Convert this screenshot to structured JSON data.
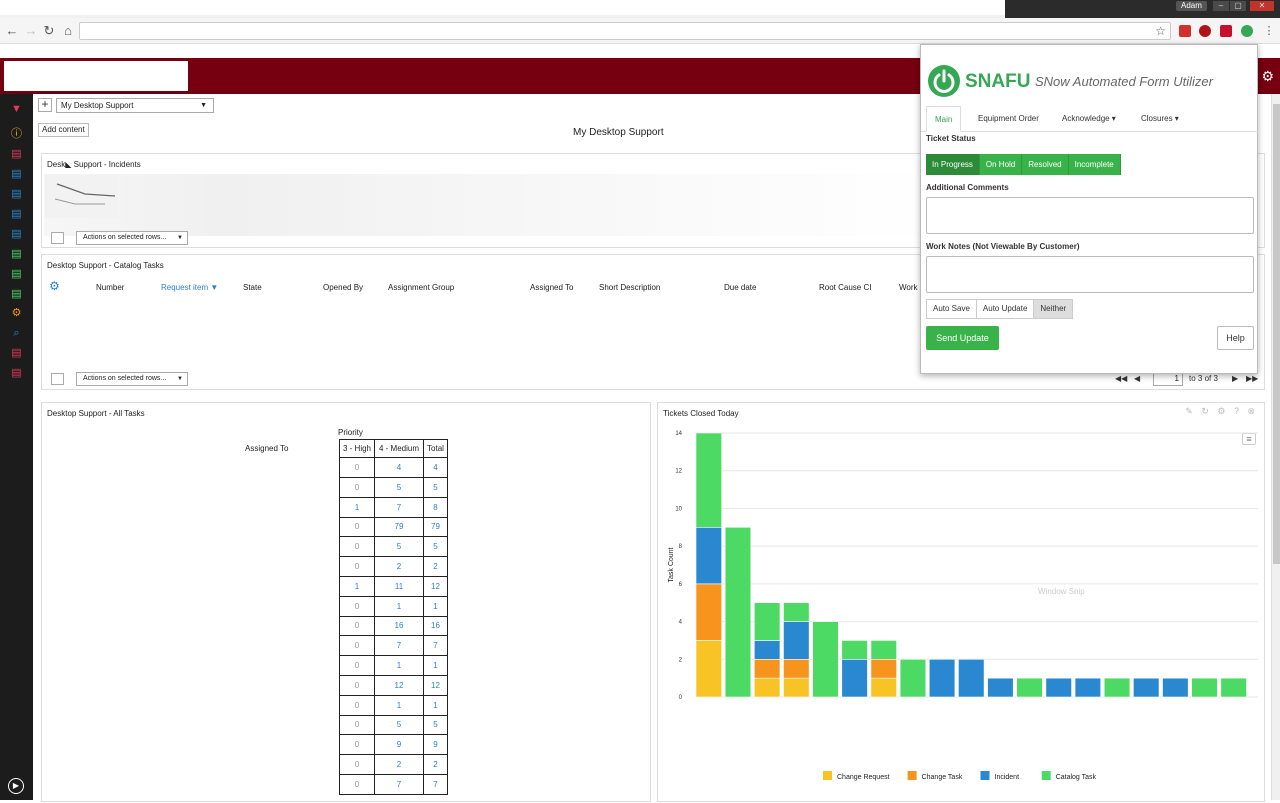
{
  "browser": {
    "user": "Adam",
    "window_buttons": [
      "–",
      "▢",
      "✕"
    ]
  },
  "dashboard": {
    "selector_value": "My Desktop Support",
    "add_content_label": "Add content",
    "title": "My  Desktop Support"
  },
  "incidents": {
    "title": "Desk◣ Support - Incidents",
    "actions_label": "Actions on selected rows..."
  },
  "catalog_tasks": {
    "title": "Desktop Support - Catalog Tasks",
    "columns": [
      "Number",
      "Request item ▼",
      "State",
      "Opened By",
      "Assignment Group",
      "Assigned To",
      "Short Description",
      "Due date",
      "Root Cause CI",
      "Work I"
    ],
    "actions_label": "Actions on selected rows...",
    "pager": {
      "first": "◀◀",
      "prev": "◀",
      "page": "1",
      "range": "to 3 of 3",
      "next": "▶",
      "last": "▶▶"
    }
  },
  "all_tasks": {
    "title": "Desktop Support - All Tasks",
    "row_header": "Assigned To",
    "group_header": "Priority",
    "headers": [
      "3 - High",
      "4 - Medium",
      "Total"
    ],
    "rows": [
      [
        "0",
        "4",
        "4"
      ],
      [
        "0",
        "5",
        "5"
      ],
      [
        "1",
        "7",
        "8"
      ],
      [
        "0",
        "79",
        "79"
      ],
      [
        "0",
        "5",
        "5"
      ],
      [
        "0",
        "2",
        "2"
      ],
      [
        "1",
        "11",
        "12"
      ],
      [
        "0",
        "1",
        "1"
      ],
      [
        "0",
        "16",
        "16"
      ],
      [
        "0",
        "7",
        "7"
      ],
      [
        "0",
        "1",
        "1"
      ],
      [
        "0",
        "12",
        "12"
      ],
      [
        "0",
        "1",
        "1"
      ],
      [
        "0",
        "5",
        "5"
      ],
      [
        "0",
        "9",
        "9"
      ],
      [
        "0",
        "2",
        "2"
      ],
      [
        "0",
        "7",
        "7"
      ]
    ]
  },
  "chart_panel": {
    "title": "Tickets Closed Today",
    "tools": "✎ ↻ ⚙ ? ⊗",
    "ghost_text": "Window Snip"
  },
  "chart_data": {
    "type": "bar",
    "stacked": true,
    "categories": [
      "",
      "",
      "",
      "",
      "",
      "",
      "",
      "",
      "",
      "",
      "",
      "",
      "",
      "",
      "",
      "",
      "",
      "",
      ""
    ],
    "ylabel": "Task Count",
    "ylim": [
      0,
      14
    ],
    "yticks": [
      0,
      2,
      4,
      6,
      8,
      10,
      12,
      14
    ],
    "grid": true,
    "legend_position": "bottom",
    "series": [
      {
        "name": "Change Request",
        "color": "#f7c325",
        "values": [
          3,
          0,
          1,
          1,
          0,
          0,
          1,
          0,
          0,
          0,
          0,
          0,
          0,
          0,
          0,
          0,
          0,
          0,
          0
        ]
      },
      {
        "name": "Change Task",
        "color": "#f7941d",
        "values": [
          3,
          0,
          1,
          1,
          0,
          0,
          1,
          0,
          0,
          0,
          0,
          0,
          0,
          0,
          0,
          0,
          0,
          0,
          0
        ]
      },
      {
        "name": "Incident",
        "color": "#2a88d0",
        "values": [
          3,
          0,
          1,
          2,
          0,
          2,
          0,
          0,
          2,
          2,
          1,
          0,
          1,
          1,
          0,
          1,
          1,
          0,
          0
        ]
      },
      {
        "name": "Catalog Task",
        "color": "#4cd964",
        "values": [
          5,
          9,
          2,
          1,
          4,
          1,
          1,
          2,
          0,
          0,
          0,
          1,
          0,
          0,
          1,
          0,
          0,
          1,
          1
        ]
      }
    ]
  },
  "snafu": {
    "name": "SNAFU",
    "subtitle": "SNow Automated Form Utilizer",
    "tabs": [
      "Main",
      "Equipment Order",
      "Acknowledge ▾",
      "Closures ▾"
    ],
    "ticket_status_label": "Ticket Status",
    "statuses": [
      "In Progress",
      "On Hold",
      "Resolved",
      "Incomplete"
    ],
    "additional_comments_label": "Additional Comments",
    "work_notes_label": "Work Notes (Not Viewable By Customer)",
    "update_modes": [
      "Auto Save",
      "Auto Update",
      "Neither"
    ],
    "send_label": "Send Update",
    "help_label": "Help"
  }
}
